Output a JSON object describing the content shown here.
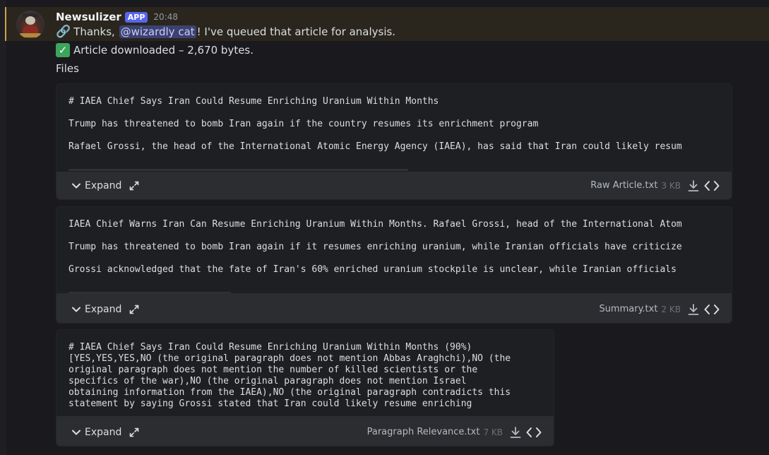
{
  "message": {
    "author": "Newsulizer",
    "app_tag": "APP",
    "timestamp": "20:48",
    "line1_pre": "Thanks, ",
    "mention": "@wizardly cat",
    "line1_post": "! I've queued that article for analysis.",
    "line2": "Article downloaded – 2,670 bytes.",
    "files_label": "Files"
  },
  "attachments": [
    {
      "lines": [
        "# IAEA Chief Says Iran Could Resume Enriching Uranium Within Months",
        "Trump has threatened to bomb Iran again if the country resumes its enrichment program",
        "Rafael Grossi, the head of the International Atomic Energy Agency (IAEA), has said that Iran could likely resum"
      ],
      "expand_label": "Expand",
      "filename": "Raw Article.txt",
      "size": "3 KB"
    },
    {
      "lines": [
        "IAEA Chief Warns Iran Can Resume Enriching Uranium Within Months. Rafael Grossi, head of the International Atom",
        "Trump has threatened to bomb Iran again if it resumes enriching uranium, while Iranian officials have criticize",
        "Grossi acknowledged that the fate of Iran's 60% enriched uranium stockpile is unclear, while Iranian officials"
      ],
      "expand_label": "Expand",
      "filename": "Summary.txt",
      "size": "2 KB"
    },
    {
      "text": "# IAEA Chief Says Iran Could Resume Enriching Uranium Within Months (90%)\n[YES,YES,YES,NO (the original paragraph does not mention Abbas Araghchi),NO (the\noriginal paragraph does not mention the number of killed scientists or the\nspecifics of the war),NO (the original paragraph does not mention Israel\nobtaining information from the IAEA),NO (the original paragraph contradicts this\nstatement by saying Grossi stated that Iran could likely resume enriching",
      "expand_label": "Expand",
      "filename": "Paragraph Relevance.txt",
      "size": "7 KB"
    }
  ],
  "icons": {
    "link": "link-icon",
    "check": "check-icon",
    "chevron": "chevron-down-icon",
    "expand": "expand-arrows-icon",
    "download": "download-icon",
    "code": "code-icon"
  },
  "colors": {
    "background": "#1a1a1e",
    "card": "#2b2d31",
    "preview": "#1e1f22",
    "app_tag": "#5865f2",
    "mention_bg": "#3c4270",
    "highlight_bar": "#c9a64a"
  }
}
